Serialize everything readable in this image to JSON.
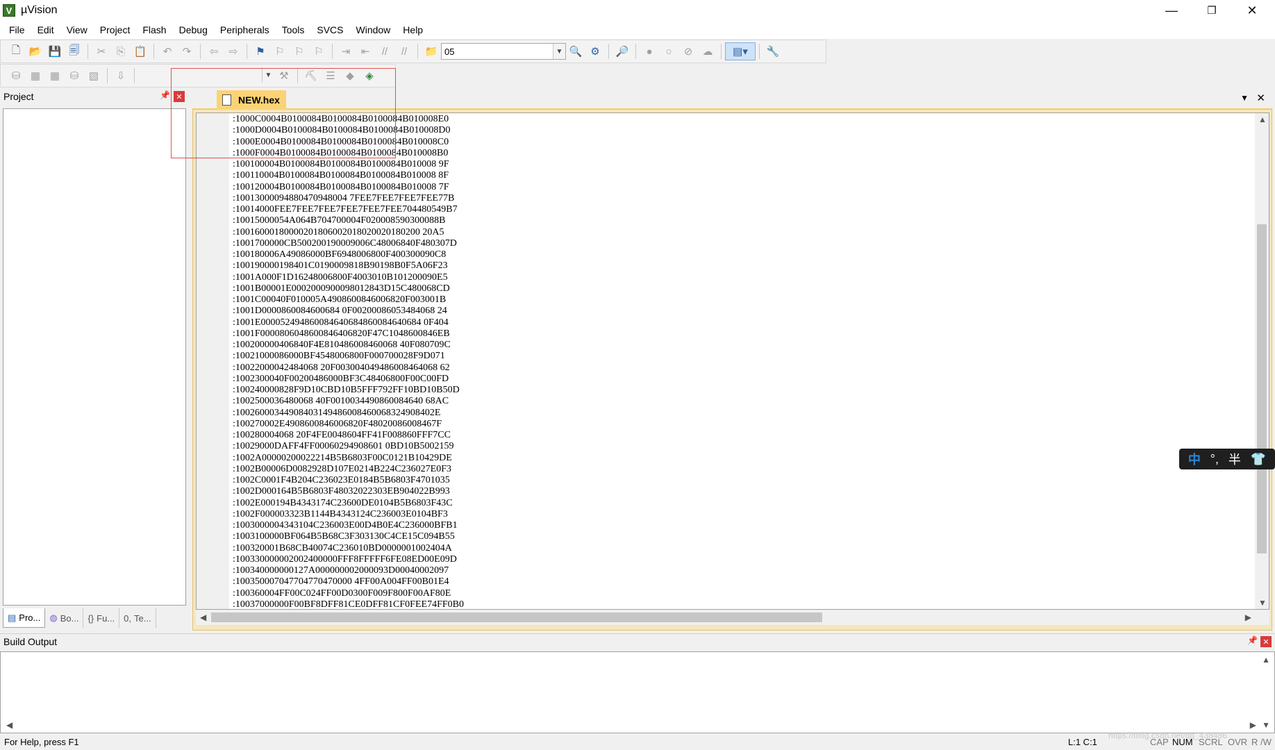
{
  "window": {
    "title": "µVision",
    "icon_letter": "V",
    "minimize_glyph": "—",
    "restore_glyph": "❐",
    "close_glyph": "✕"
  },
  "menu": [
    "File",
    "Edit",
    "View",
    "Project",
    "Flash",
    "Debug",
    "Peripherals",
    "Tools",
    "SVCS",
    "Window",
    "Help"
  ],
  "toolbar": {
    "target_value": "05"
  },
  "project_panel": {
    "title": "Project",
    "tabs": [
      "Pro...",
      "Bo...",
      "Fu...",
      "Te..."
    ]
  },
  "editor": {
    "active_tab": "NEW.hex",
    "lines": [
      ":1000C0004B0100084B0100084B0100084B010008E0",
      ":1000D0004B0100084B0100084B0100084B010008D0",
      ":1000E0004B0100084B0100084B0100084B010008C0",
      ":1000F0004B0100084B0100084B0100084B010008B0",
      ":100100004B0100084B0100084B0100084B010008 9F",
      ":100110004B0100084B0100084B0100084B010008 8F",
      ":100120004B0100084B0100084B0100084B010008 7F",
      ":10013000094880470948004 7FEE7FEE7FEE7FEE77B",
      ":10014000FEE7FEE7FEE7FEE7FEE7FEE704480549B7",
      ":10015000054A064B704700004F020008590300088B",
      ":10016000180000201806002018020020180200 20A5",
      ":1001700000CB500200190009006C48006840F480307D",
      ":100180006A49086000BF6948006800F400300090C8",
      ":100190000198401C0190009818B90198B0F5A06F23",
      ":1001A000F1D16248006800F4003010B101200090E5",
      ":1001B00001E0002000900098012843D15C480068CD",
      ":1001C00040F010005A4908600846006820F003001B",
      ":1001D0000860084600684 0F00200086053484068 24",
      ":1001E000052494860084640684860084640684 0F404",
      ":1001F0000806048600846406820F47C1048600846EB",
      ":100200000406840F4E810486008460068 40F080709C",
      ":10021000086000BF4548006800F000700028F9D071",
      ":10022000042484068 20F003004049486008464068 62",
      ":1002300040F00200486000BF3C48406800F00C00FD",
      ":100240000828F9D10CBD10B5FFF792FF10BD10B50D",
      ":1002500036480068 40F0010034490860084640 68AC",
      ":10026000344908403149486008460068324908402E",
      ":100270002E4908600846006820F48020086008467F",
      ":100280004068 20F4FE0048604FF41F008860FFF7CC",
      ":10029000DAFF4FF00060294908601 0BD10B5002159",
      ":1002A00000200022214B5B6803F00C0121B10429DE",
      ":1002B00006D0082928D107E0214B224C236027E0F3",
      ":1002C0001F4B204C236023E0184B5B6803F4701035",
      ":1002D000164B5B6803F48032022303EB904022B993",
      ":1002E000194B4343174C23600DE0104B5B6803F43C",
      ":1002F000003323B1144B4343124C236003E0104BF3",
      ":1003000004343104C236003E00D4B0E4C236000BFB1",
      ":1003100000BF064B5B68C3F303130C4CE15C094B55",
      ":100320001B68CB40074C236010BD0000001002404A",
      ":100330000002002400000FFF8FFFFF6FE08ED00E09D",
      ":100340000000127A000000002000093D00040002097",
      ":100350007047704770470000 4FF00A004FF00B01E4",
      ":100360004FF00C024FF00D0300F009F800F00AF80E",
      ":10037000000F00BF8DFF81CE0DFF81CF0FEE74FF0B0"
    ]
  },
  "build_output": {
    "title": "Build Output"
  },
  "status": {
    "help": "For Help, press F1",
    "position": "L:1 C:1",
    "cap": "CAP",
    "num": "NUM",
    "scrl": "SCRL",
    "ovr": "OVR",
    "rw": "R /W"
  },
  "ime": {
    "lang": "中",
    "punct": "°,",
    "half": "半"
  },
  "watermark": "https://blog.csdn.net/qq_438486"
}
